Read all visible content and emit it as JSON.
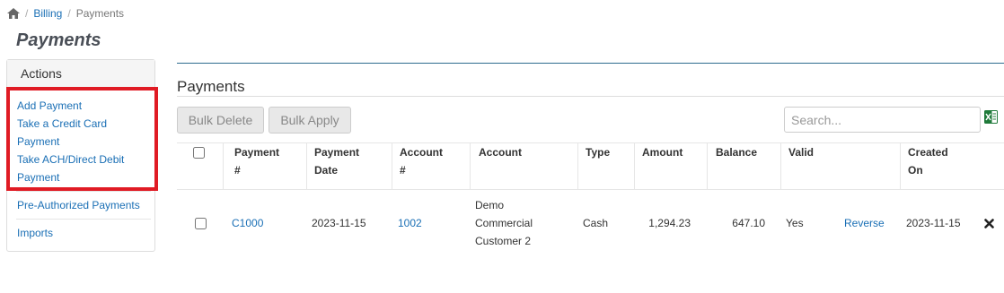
{
  "breadcrumb": {
    "home_icon": "home-icon",
    "separator": "/",
    "billing": "Billing",
    "current": "Payments"
  },
  "page": {
    "title": "Payments"
  },
  "actions": {
    "header": "Actions",
    "add_payment": "Add Payment",
    "credit_card": [
      "Take a Credit Card",
      "Payment"
    ],
    "ach": [
      "Take ACH/Direct Debit",
      "Payment"
    ],
    "pre_authorized": "Pre-Authorized Payments",
    "imports": "Imports"
  },
  "section": {
    "title": "Payments"
  },
  "toolbar": {
    "bulk_delete": "Bulk Delete",
    "bulk_apply": "Bulk Apply",
    "search_placeholder": "Search...",
    "export_icon": "excel-icon"
  },
  "table": {
    "headers": {
      "payment_num": [
        "Payment",
        "#"
      ],
      "payment_date": [
        "Payment",
        "Date"
      ],
      "account_num": [
        "Account",
        "#"
      ],
      "account": "Account",
      "type": "Type",
      "amount": "Amount",
      "balance": "Balance",
      "valid": "Valid",
      "created_on": [
        "Created",
        "On"
      ]
    },
    "rows": [
      {
        "payment_num": "C1000",
        "payment_date": "2023-11-15",
        "account_num": "1002",
        "account": [
          "Demo",
          "Commercial",
          "Customer 2"
        ],
        "type": "Cash",
        "amount": "1,294.23",
        "balance": "647.10",
        "valid": "Yes",
        "action": "Reverse",
        "created_on": "2023-11-15"
      }
    ]
  },
  "colors": {
    "link": "#1a6fb5",
    "highlight": "#e01b24",
    "accent_rule": "#2e6b8f"
  }
}
